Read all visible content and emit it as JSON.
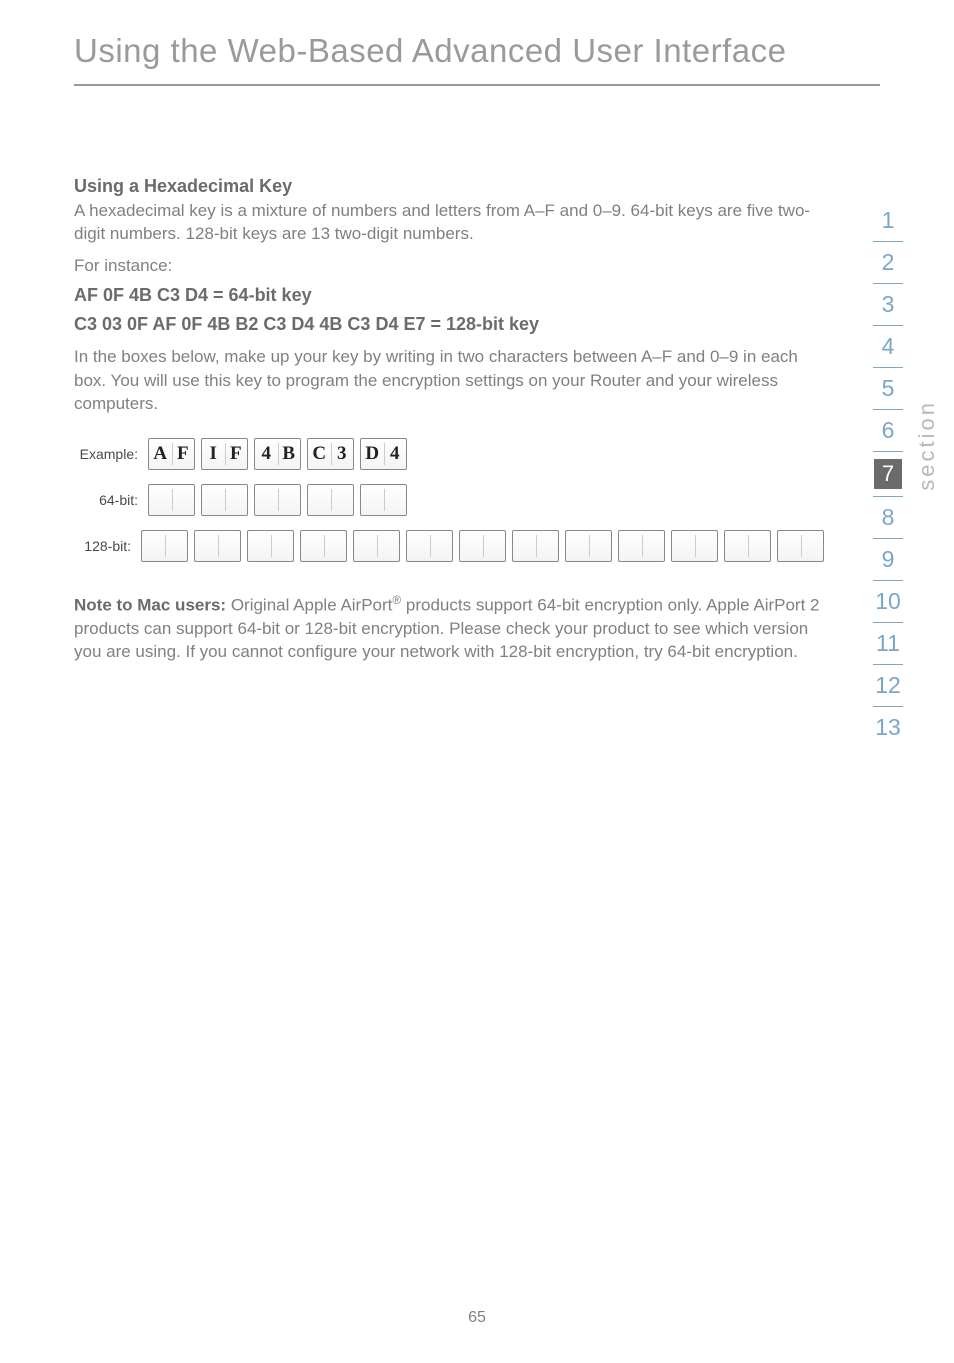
{
  "page_title": "Using the Web-Based Advanced User Interface",
  "heading_hex": "Using a Hexadecimal Key",
  "para_hex": "A hexadecimal key is a mixture of numbers and letters from A–F and 0–9. 64-bit keys are five two-digit numbers. 128-bit keys are 13 two-digit numbers.",
  "for_instance": "For instance:",
  "key64_line": "AF 0F 4B C3 D4 = 64-bit key",
  "key128_line": "C3 03 0F AF 0F 4B B2 C3 D4 4B C3 D4 E7 = 128-bit key",
  "para_instruct": "In the boxes below, make up your key by writing in two characters between A–F and 0–9 in each box. You will use this key to program the encryption settings on your Router and your wireless computers.",
  "key_rows": {
    "example": {
      "label": "Example:",
      "boxes": [
        "AF",
        "IF",
        "4B",
        "C3",
        "D4"
      ]
    },
    "r64": {
      "label": "64-bit:",
      "count": 5
    },
    "r128": {
      "label": "128-bit:",
      "count": 13
    }
  },
  "mac_note_lead": "Note to Mac users:",
  "mac_note_pre": " Original Apple AirPort",
  "mac_note_reg": "®",
  "mac_note_rest": " products support 64-bit encryption only. Apple AirPort 2 products can support 64-bit or 128-bit encryption. Please check your product to see which version you are using. If you cannot configure your network with 128-bit encryption, try 64-bit encryption.",
  "nav_numbers": [
    "1",
    "2",
    "3",
    "4",
    "5",
    "6",
    "7",
    "8",
    "9",
    "10",
    "11",
    "12",
    "13"
  ],
  "nav_active_index": 6,
  "section_label": "section",
  "page_number": "65"
}
